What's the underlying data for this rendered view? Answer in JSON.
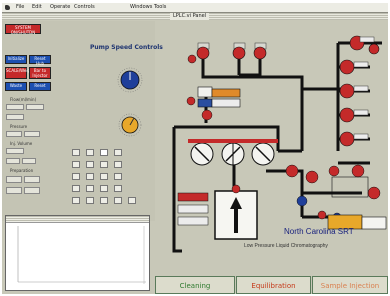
{
  "menubar": {
    "items": [
      "File",
      "Edit",
      "Operate",
      "Controls",
      "Windows",
      "Tools"
    ]
  },
  "window": {
    "title": "LPLC.vi Panel"
  },
  "left_panel": {
    "buttons": [
      {
        "label": "SYSTEM ON/SHUTDN",
        "color": "red"
      },
      {
        "label": "Initialize",
        "color": "blue"
      },
      {
        "label": "Reset Hub",
        "color": "blue"
      },
      {
        "label": "SCALE/Weigh",
        "color": "red"
      },
      {
        "label": "Bar to Injector",
        "color": "red"
      },
      {
        "label": "Waste",
        "color": "blue"
      },
      {
        "label": "Reset",
        "color": "blue"
      }
    ],
    "labels": [
      "Flow(ml/min)",
      "Pressure",
      "Inj. Volume",
      "Preparation"
    ],
    "pump_title": "Pump Speed Controls"
  },
  "schematic": {
    "institution": "North Carolina SRT",
    "subtitle": "Low Pressure Liquid Chromatography",
    "accent": "#c42a2a",
    "pipe_color": "#111111"
  },
  "tabs": [
    {
      "label": "Cleaning",
      "color": "#2f7a2f"
    },
    {
      "label": "Equilibration",
      "color": "#c53a1a"
    },
    {
      "label": "Sample Injection",
      "color": "#d98050"
    }
  ]
}
